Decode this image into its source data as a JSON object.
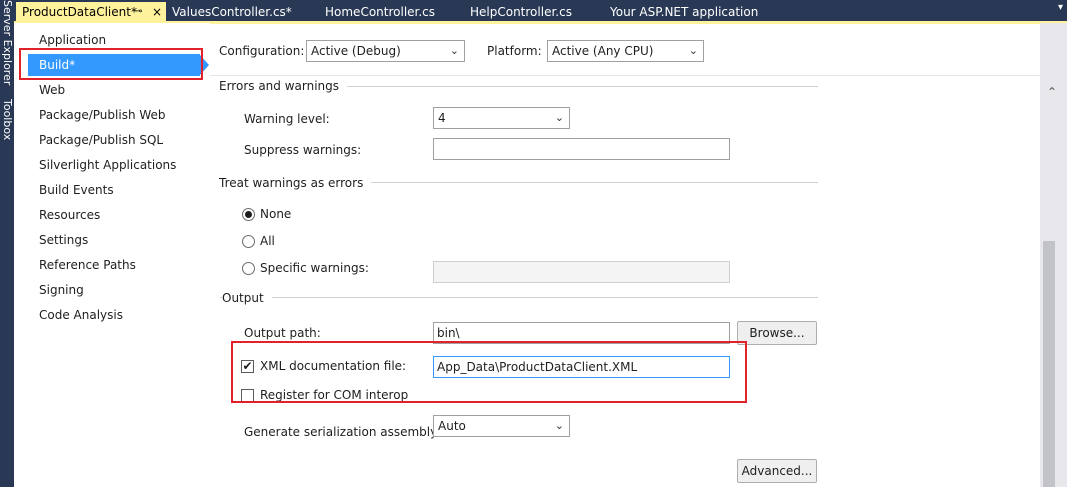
{
  "side_strip": {
    "server_explorer": "Server Explorer",
    "toolbox": "Toolbox"
  },
  "tabs": [
    {
      "label": "ProductDataClient*",
      "active": true
    },
    {
      "label": "ValuesController.cs*"
    },
    {
      "label": "HomeController.cs"
    },
    {
      "label": "HelpController.cs"
    },
    {
      "label": "Your ASP.NET application"
    }
  ],
  "tab_icons": {
    "pin": "⊸",
    "close": "×",
    "dropdown": "▾"
  },
  "nav": {
    "items": [
      "Application",
      "Build*",
      "Web",
      "Package/Publish Web",
      "Package/Publish SQL",
      "Silverlight Applications",
      "Build Events",
      "Resources",
      "Settings",
      "Reference Paths",
      "Signing",
      "Code Analysis"
    ],
    "selected_index": 1
  },
  "top": {
    "configuration_label": "Configuration:",
    "configuration_value": "Active (Debug)",
    "platform_label": "Platform:",
    "platform_value": "Active (Any CPU)"
  },
  "errors": {
    "title": "Errors and warnings",
    "warning_level_label": "Warning level:",
    "warning_level_value": "4",
    "suppress_label": "Suppress warnings:",
    "suppress_value": ""
  },
  "treat": {
    "title": "Treat warnings as errors",
    "none_label": "None",
    "all_label": "All",
    "specific_label": "Specific warnings:",
    "specific_value": "",
    "selected": "None"
  },
  "output": {
    "title": "Output",
    "path_label": "Output path:",
    "path_value": "bin\\",
    "browse_label": "Browse...",
    "xml_label": "XML documentation file:",
    "xml_checked": true,
    "xml_value": "App_Data\\ProductDataClient.XML",
    "com_label": "Register for COM interop",
    "com_checked": false,
    "serialization_label": "Generate serialization assembly:",
    "serialization_value": "Auto",
    "advanced_label": "Advanced..."
  },
  "icons": {
    "chevron": "⌄",
    "check": "✔",
    "scroll_up": "⌃"
  },
  "colors": {
    "tab_bar": "#293955",
    "active_tab": "#fff29d",
    "selection": "#3399ff",
    "highlight_box": "#e3212a"
  }
}
